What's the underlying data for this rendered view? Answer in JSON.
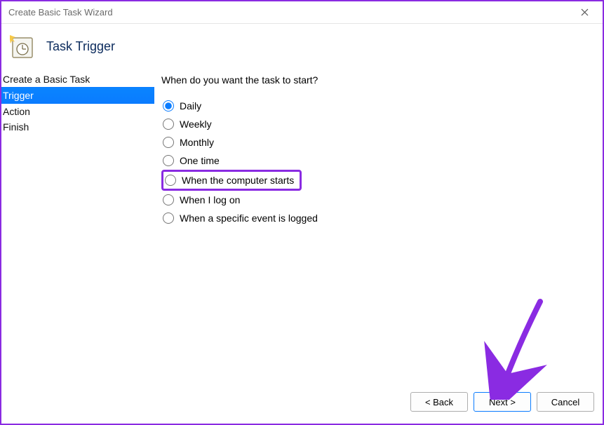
{
  "window": {
    "title": "Create Basic Task Wizard"
  },
  "header": {
    "heading": "Task Trigger"
  },
  "steps": {
    "items": [
      {
        "label": "Create a Basic Task",
        "selected": false
      },
      {
        "label": "Trigger",
        "selected": true
      },
      {
        "label": "Action",
        "selected": false
      },
      {
        "label": "Finish",
        "selected": false
      }
    ]
  },
  "content": {
    "prompt": "When do you want the task to start?",
    "options": [
      {
        "label": "Daily",
        "checked": true,
        "highlighted": false
      },
      {
        "label": "Weekly",
        "checked": false,
        "highlighted": false
      },
      {
        "label": "Monthly",
        "checked": false,
        "highlighted": false
      },
      {
        "label": "One time",
        "checked": false,
        "highlighted": false
      },
      {
        "label": "When the computer starts",
        "checked": false,
        "highlighted": true
      },
      {
        "label": "When I log on",
        "checked": false,
        "highlighted": false
      },
      {
        "label": "When a specific event is logged",
        "checked": false,
        "highlighted": false
      }
    ]
  },
  "footer": {
    "back": "< Back",
    "next": "Next >",
    "cancel": "Cancel"
  },
  "annotation": {
    "arrow_color": "#8a2be2"
  }
}
